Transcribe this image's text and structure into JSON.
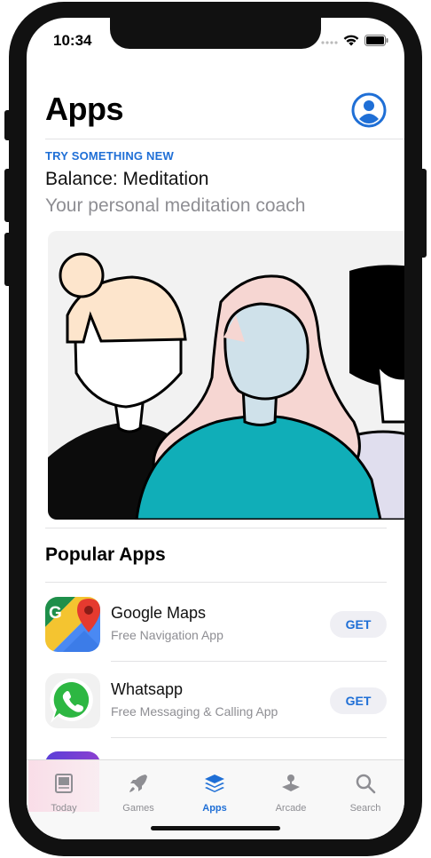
{
  "status_bar": {
    "time": "10:34"
  },
  "header": {
    "title": "Apps",
    "account_icon": "person-circle-icon"
  },
  "feature": {
    "eyebrow": "TRY SOMETHING NEW",
    "title": "Balance: Meditation",
    "subtitle": "Your personal meditation coach"
  },
  "popular": {
    "title": "Popular Apps",
    "apps": [
      {
        "name": "Google Maps",
        "desc": "Free Navigation App",
        "button": "GET",
        "icon": "google-maps-icon"
      },
      {
        "name": "Whatsapp",
        "desc": "Free Messaging & Calling App",
        "button": "GET",
        "icon": "whatsapp-icon"
      }
    ]
  },
  "tabbar": {
    "tabs": [
      {
        "label": "Today",
        "icon": "today-icon"
      },
      {
        "label": "Games",
        "icon": "rocket-icon"
      },
      {
        "label": "Apps",
        "icon": "layers-icon"
      },
      {
        "label": "Arcade",
        "icon": "joystick-icon"
      },
      {
        "label": "Search",
        "icon": "search-icon"
      }
    ],
    "active": "Apps"
  },
  "colors": {
    "accent": "#1f6fd6",
    "teal": "#10aeb8",
    "pink": "#f6d6d2"
  }
}
